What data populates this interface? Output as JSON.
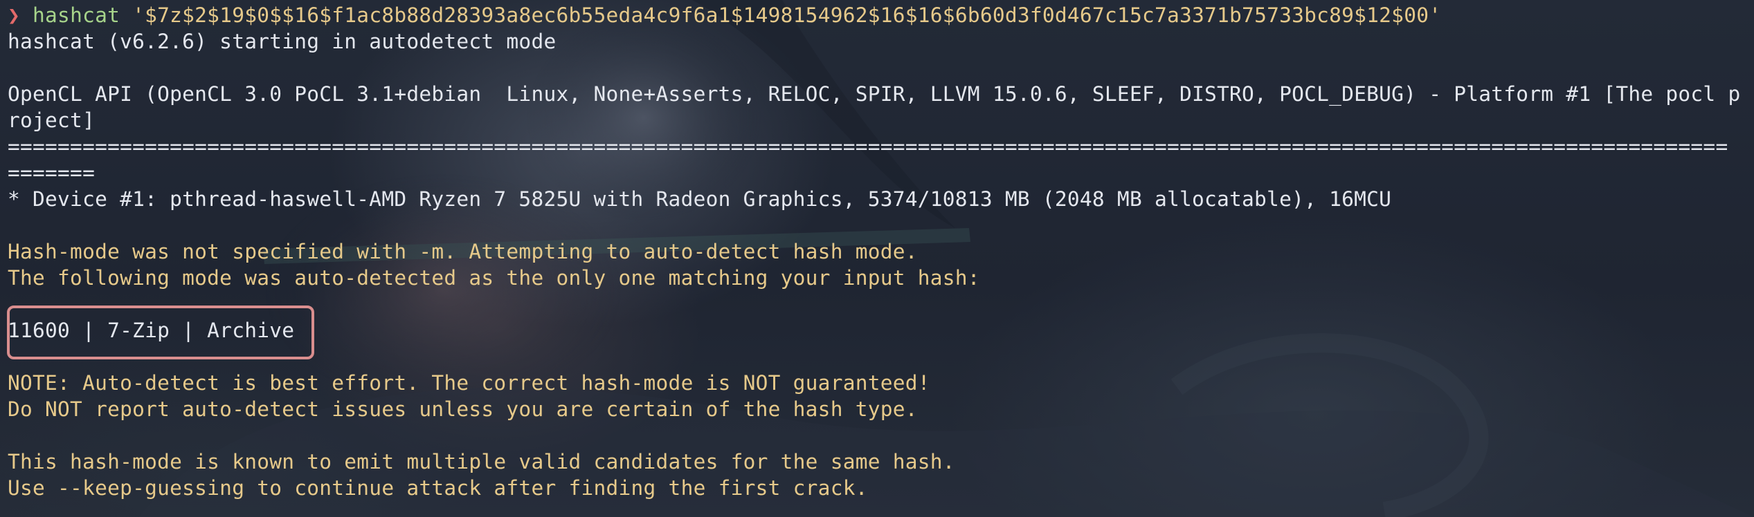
{
  "prompt": {
    "arrow": "❯",
    "command": "hashcat",
    "argument": " '$7z$2$19$0$$16$f1ac8b88d28393a8ec6b55eda4c9f6a1$1498154962$16$16$6b60d3f0d467c15c7a3371b75733bc89$12$00'"
  },
  "output": {
    "start_line": "hashcat (v6.2.6) starting in autodetect mode",
    "opencl_line1": "OpenCL API (OpenCL 3.0 PoCL 3.1+debian  Linux, None+Asserts, RELOC, SPIR, LLVM 15.0.6, SLEEF, DISTRO, POCL_DEBUG) - Platform #1 [The pocl p",
    "opencl_line2": "roject]",
    "separator_line1": "==========================================================================================================================================",
    "separator_line2": "=======",
    "device_line": "* Device #1: pthread-haswell-AMD Ryzen 7 5825U with Radeon Graphics, 5374/10813 MB (2048 MB allocatable), 16MCU",
    "hash_mode_line1": "Hash-mode was not specified with -m. Attempting to auto-detect hash mode.",
    "hash_mode_line2": "The following mode was auto-detected as the only one matching your input hash:",
    "detected_mode": "11600 | 7-Zip | Archive",
    "note_line1": "NOTE: Auto-detect is best effort. The correct hash-mode is NOT guaranteed!",
    "note_line2": "Do NOT report auto-detect issues unless you are certain of the hash type.",
    "candidates_line1": "This hash-mode is known to emit multiple valid candidates for the same hash.",
    "candidates_line2": "Use --keep-guessing to continue attack after finding the first crack."
  },
  "colors": {
    "background": "#1f2532",
    "text_white": "#e4e7ee",
    "text_yellow": "#e6c98a",
    "prompt_arrow": "#e36a6a",
    "command_green": "#a6d38a",
    "highlight_border": "#d98e8e"
  }
}
